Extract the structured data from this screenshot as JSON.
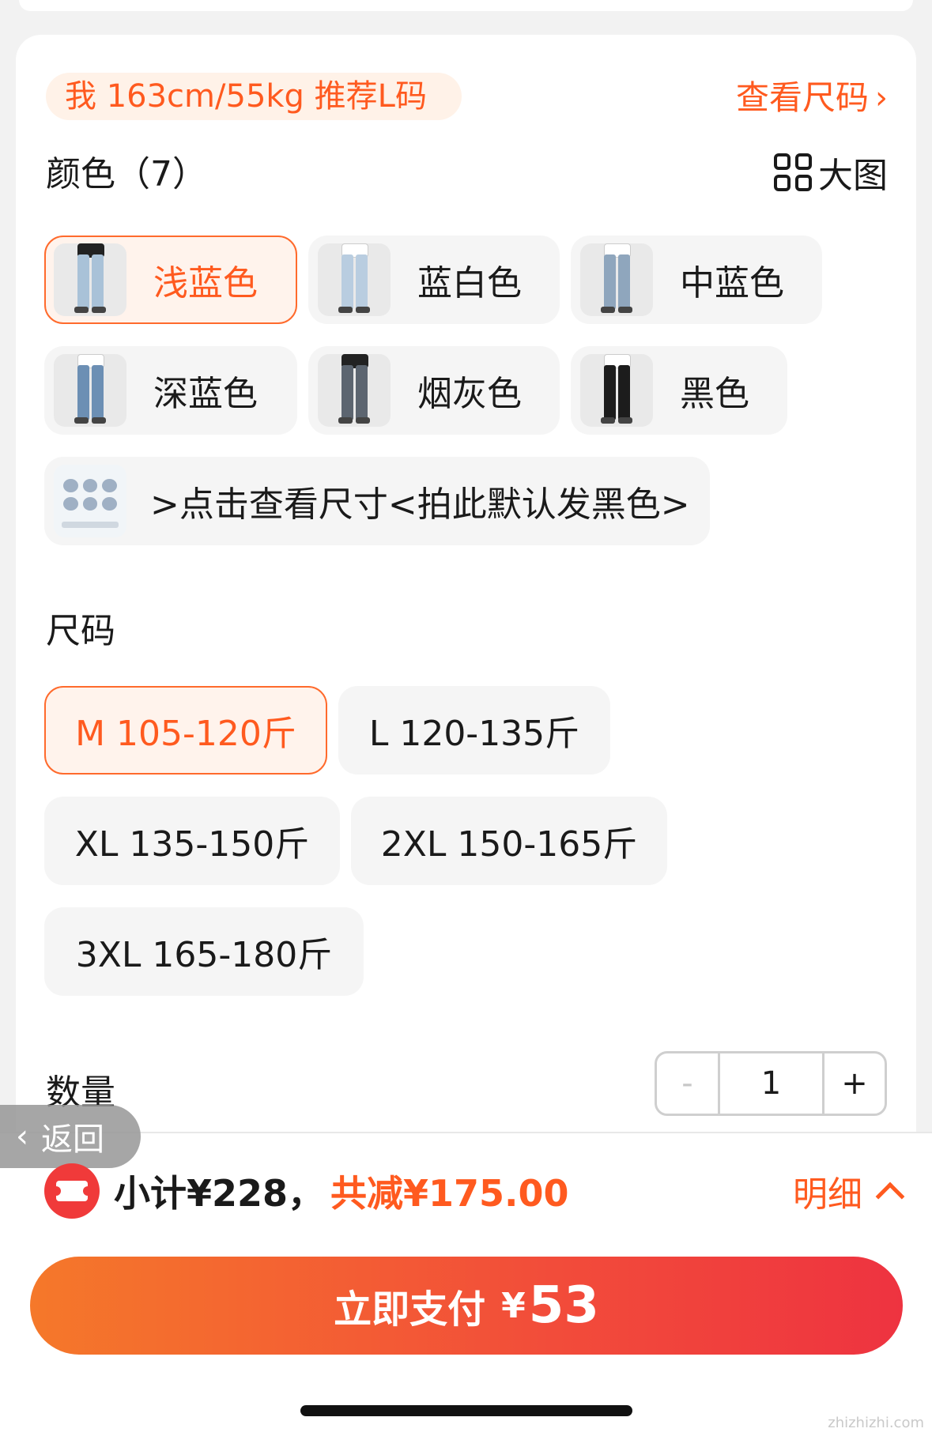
{
  "recommendation": "我 163cm/55kg 推荐L码",
  "size_chart_link": "查看尺码",
  "color_section": {
    "title": "颜色（7）",
    "big_image_label": "大图"
  },
  "colors": [
    {
      "label": "浅蓝色",
      "selected": true,
      "jean": "#a9c2d8"
    },
    {
      "label": "蓝白色",
      "selected": false,
      "jean": "#b9cde0"
    },
    {
      "label": "中蓝色",
      "selected": false,
      "jean": "#8fa6bd"
    },
    {
      "label": "深蓝色",
      "selected": false,
      "jean": "#6c8fb4"
    },
    {
      "label": "烟灰色",
      "selected": false,
      "jean": "#5c6570"
    },
    {
      "label": "黑色",
      "selected": false,
      "jean": "#1c1c1c"
    },
    {
      "label": ">点击查看尺寸<拍此默认发黑色>",
      "selected": false
    }
  ],
  "size_section": {
    "title": "尺码"
  },
  "sizes": [
    {
      "label": "M 105-120斤",
      "selected": true
    },
    {
      "label": "L 120-135斤",
      "selected": false
    },
    {
      "label": "XL 135-150斤",
      "selected": false
    },
    {
      "label": "2XL 150-165斤",
      "selected": false
    },
    {
      "label": "3XL 165-180斤",
      "selected": false
    }
  ],
  "quantity": {
    "label": "数量",
    "minus": "-",
    "value": "1",
    "plus": "+"
  },
  "back_label": "返回",
  "summary": {
    "subtotal": "小计¥228，",
    "discount": "共减¥175.00",
    "detail": "明细"
  },
  "pay": {
    "label": "立即支付",
    "currency": "¥",
    "amount": "53"
  },
  "watermark": "zhizhizhi.com",
  "colors_theme": {
    "accent": "#ff5a1f",
    "button_start": "#f5782a",
    "button_end": "#ee3340"
  }
}
